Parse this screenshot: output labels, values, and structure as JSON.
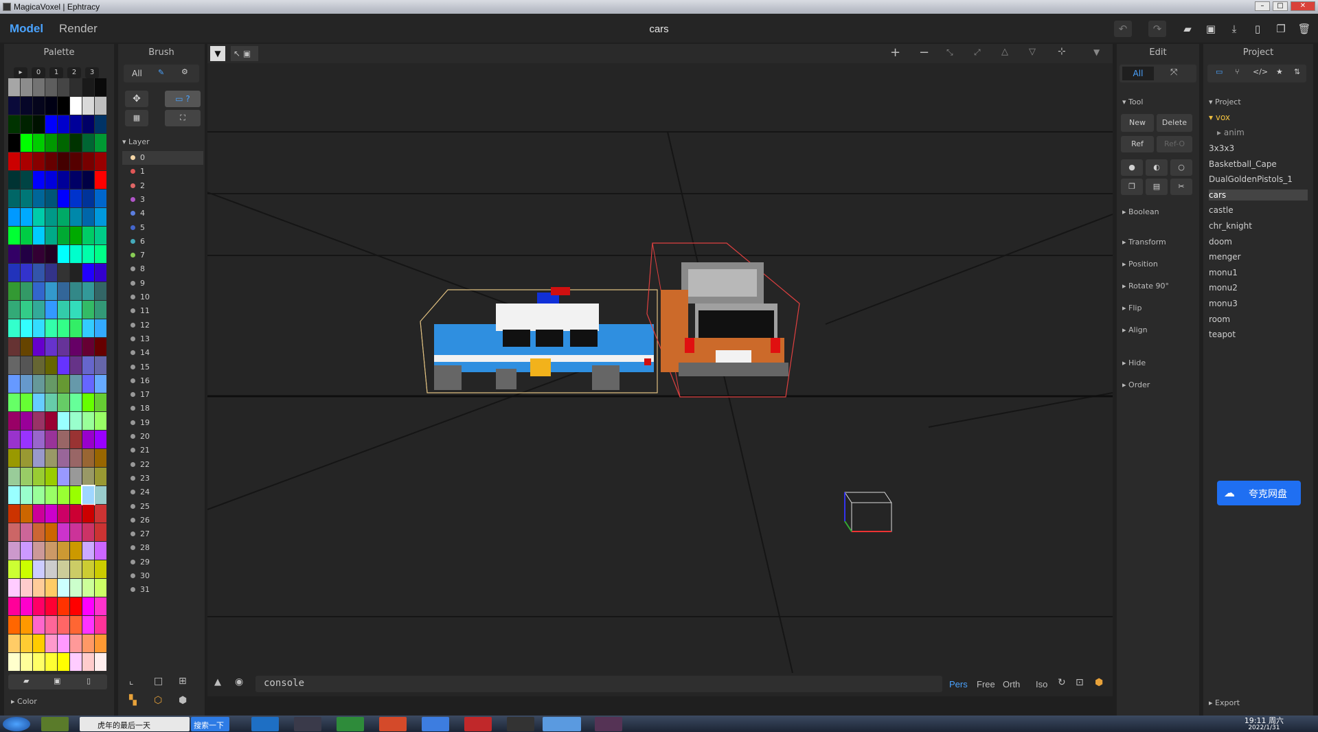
{
  "window": {
    "title": "MagicaVoxel | Ephtracy",
    "minimize": "–",
    "maximize": "□",
    "close": "✕"
  },
  "header": {
    "mode_model": "Model",
    "mode_render": "Render",
    "doc_title": "cars"
  },
  "colors": {
    "accent": "#4aa3ff",
    "panel": "#2a2a2a",
    "viewport": "#252525",
    "selection_box": "#e0c080",
    "selection_box_red": "#e04040"
  },
  "palette": {
    "title": "Palette",
    "pages": [
      "▸",
      "0",
      "1",
      "2",
      "3"
    ],
    "footer_label": "Color",
    "colors": [
      "#a6a6a6",
      "#8c8c8c",
      "#737373",
      "#5e5e5e",
      "#454545",
      "#2e2e2e",
      "#1a1a1a",
      "#0a0a0a",
      "#0a0a3a",
      "#060628",
      "#05051c",
      "#000014",
      "#000000",
      "#ffffff",
      "#d9d9d9",
      "#bfbfbf",
      "#003300",
      "#002200",
      "#001100",
      "#0000ff",
      "#0000cc",
      "#000099",
      "#000066",
      "#003366",
      "#000000",
      "#00ff00",
      "#00cc00",
      "#009900",
      "#006600",
      "#003300",
      "#006633",
      "#009933",
      "#cc0000",
      "#aa0000",
      "#880000",
      "#660000",
      "#440000",
      "#550000",
      "#770000",
      "#990000",
      "#003333",
      "#004444",
      "#0000ff",
      "#0000dd",
      "#000099",
      "#000066",
      "#000044",
      "#ff0000",
      "#006666",
      "#007777",
      "#006699",
      "#005577",
      "#0000ff",
      "#0033cc",
      "#003399",
      "#0066cc",
      "#0099ff",
      "#00aaff",
      "#00ccaa",
      "#009988",
      "#00aa66",
      "#0088aa",
      "#0066aa",
      "#0099dd",
      "#00ff33",
      "#00cc44",
      "#00ccff",
      "#00aa88",
      "#00aa33",
      "#00aa00",
      "#00cc66",
      "#00cc88",
      "#330066",
      "#220044",
      "#330033",
      "#220022",
      "#00ffff",
      "#00ffcc",
      "#00ffaa",
      "#00ff88",
      "#2233bb",
      "#3333cc",
      "#3355aa",
      "#333388",
      "#333333",
      "#222222",
      "#2200ff",
      "#3300cc",
      "#339933",
      "#339966",
      "#3366cc",
      "#3399cc",
      "#336699",
      "#338888",
      "#339999",
      "#336666",
      "#33aa77",
      "#33cc88",
      "#33aa99",
      "#3399ff",
      "#33ccaa",
      "#33ddbb",
      "#33bb66",
      "#339977",
      "#33ffcc",
      "#33ffff",
      "#33ddff",
      "#33ffaa",
      "#33ff88",
      "#33ee66",
      "#33ccff",
      "#33aaff",
      "#663333",
      "#664400",
      "#6600cc",
      "#6633cc",
      "#663399",
      "#660066",
      "#660033",
      "#660000",
      "#666666",
      "#555555",
      "#666633",
      "#666600",
      "#6633ff",
      "#663388",
      "#6666cc",
      "#6666aa",
      "#6699ff",
      "#6699cc",
      "#669999",
      "#669966",
      "#669933",
      "#6699aa",
      "#6666ff",
      "#66aaff",
      "#66ff66",
      "#66ff33",
      "#66ccff",
      "#66ccaa",
      "#66cc66",
      "#66ff99",
      "#66ff00",
      "#66cc33",
      "#990066",
      "#990099",
      "#993366",
      "#990033",
      "#99ffff",
      "#99ffcc",
      "#99ff99",
      "#99ff66",
      "#9933cc",
      "#9933ff",
      "#9966cc",
      "#993399",
      "#996666",
      "#993333",
      "#9900cc",
      "#9900ff",
      "#999900",
      "#999933",
      "#9999cc",
      "#999966",
      "#996699",
      "#996666",
      "#996633",
      "#996600",
      "#99cc99",
      "#99cc66",
      "#99cc33",
      "#99cc00",
      "#9999ff",
      "#999999",
      "#999966",
      "#999933",
      "#99ffff",
      "#99ffcc",
      "#99ff99",
      "#99ff66",
      "#99ff33",
      "#99ff00",
      "#9fd6ff",
      "#99cccc",
      "#cc3300",
      "#cc6600",
      "#cc0099",
      "#cc00cc",
      "#cc0066",
      "#cc0033",
      "#cc0000",
      "#cc3333",
      "#cc6666",
      "#cc6699",
      "#cc6633",
      "#cc6600",
      "#cc33cc",
      "#cc3399",
      "#cc3366",
      "#cc3333",
      "#cc99cc",
      "#cc99ff",
      "#cc9999",
      "#cc9966",
      "#cc9933",
      "#cc9900",
      "#ccaaff",
      "#cc66ff",
      "#ccff33",
      "#ccff00",
      "#ccccff",
      "#cccccc",
      "#cccc99",
      "#cccc66",
      "#cccc33",
      "#cccc00",
      "#ffccff",
      "#ffcccc",
      "#ffcc99",
      "#ffcc66",
      "#ccffff",
      "#ccffcc",
      "#ccff99",
      "#ccff66",
      "#ff0099",
      "#ff00cc",
      "#ff0066",
      "#ff0033",
      "#ff3300",
      "#ff0000",
      "#ff00ff",
      "#ff33cc",
      "#ff6600",
      "#ff9900",
      "#ff66cc",
      "#ff6699",
      "#ff6666",
      "#ff6633",
      "#ff33ff",
      "#ff3399",
      "#ffcc66",
      "#ffcc33",
      "#ffcc00",
      "#ff99cc",
      "#ff99ff",
      "#ff9999",
      "#ff9966",
      "#ff9933",
      "#ffffcc",
      "#ffff99",
      "#ffff66",
      "#ffff33",
      "#ffff00",
      "#ffccff",
      "#ffcccc",
      "#ffeeee"
    ],
    "selected_index": 182
  },
  "brush": {
    "title": "Brush",
    "filter": "All",
    "layer_section": "Layer",
    "layers": [
      {
        "label": "0",
        "color": "#f5d6a6"
      },
      {
        "label": "1",
        "color": "#e05656"
      },
      {
        "label": "2",
        "color": "#e06666"
      },
      {
        "label": "3",
        "color": "#b055c8"
      },
      {
        "label": "4",
        "color": "#5b7ee0"
      },
      {
        "label": "5",
        "color": "#4466cc"
      },
      {
        "label": "6",
        "color": "#44aabb"
      },
      {
        "label": "7",
        "color": "#88cc55"
      },
      {
        "label": "8",
        "color": "#999999"
      },
      {
        "label": "9",
        "color": "#999999"
      },
      {
        "label": "10",
        "color": "#999999"
      },
      {
        "label": "11",
        "color": "#999999"
      },
      {
        "label": "12",
        "color": "#999999"
      },
      {
        "label": "13",
        "color": "#999999"
      },
      {
        "label": "14",
        "color": "#999999"
      },
      {
        "label": "15",
        "color": "#999999"
      },
      {
        "label": "16",
        "color": "#999999"
      },
      {
        "label": "17",
        "color": "#999999"
      },
      {
        "label": "18",
        "color": "#999999"
      },
      {
        "label": "19",
        "color": "#999999"
      },
      {
        "label": "20",
        "color": "#999999"
      },
      {
        "label": "21",
        "color": "#999999"
      },
      {
        "label": "22",
        "color": "#999999"
      },
      {
        "label": "23",
        "color": "#999999"
      },
      {
        "label": "24",
        "color": "#999999"
      },
      {
        "label": "25",
        "color": "#999999"
      },
      {
        "label": "26",
        "color": "#999999"
      },
      {
        "label": "27",
        "color": "#999999"
      },
      {
        "label": "28",
        "color": "#999999"
      },
      {
        "label": "29",
        "color": "#999999"
      },
      {
        "label": "30",
        "color": "#999999"
      },
      {
        "label": "31",
        "color": "#999999"
      }
    ]
  },
  "edit": {
    "title": "Edit",
    "filter": "All",
    "tool_section": "Tool",
    "new": "New",
    "delete": "Delete",
    "ref": "Ref",
    "ref_o": "Ref-O",
    "sections": [
      "Boolean",
      "Transform",
      "Position",
      "Rotate 90°",
      "Flip",
      "Align",
      "Hide",
      "Order"
    ]
  },
  "project": {
    "title": "Project",
    "section": "Project",
    "folder": "vox",
    "subfolder": "anim",
    "items": [
      "3x3x3",
      "Basketball_Cape",
      "DualGoldenPistols_1",
      "cars",
      "castle",
      "chr_knight",
      "doom",
      "menger",
      "monu1",
      "monu2",
      "monu3",
      "room",
      "teapot"
    ],
    "selected": "cars",
    "export": "Export"
  },
  "console": {
    "placeholder": "console"
  },
  "view_modes": [
    "Pers",
    "Free",
    "Orth",
    "Iso"
  ],
  "active_view": "Pers",
  "kuake": {
    "label": "夸克网盘"
  },
  "taskbar": {
    "ie_tab": "虎年的最后一天",
    "search_btn": "搜索一下",
    "time": "19:11 周六",
    "date": "2022/1/31"
  }
}
